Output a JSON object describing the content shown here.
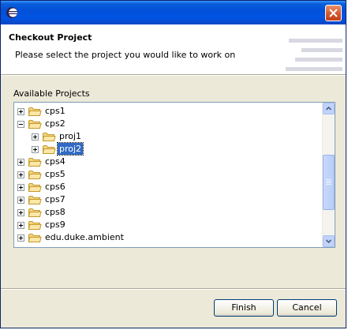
{
  "window": {
    "title": "",
    "close_icon": "close-icon"
  },
  "header": {
    "title": "Checkout Project",
    "description": "Please select the project you would like to work on"
  },
  "tree": {
    "label": "Available Projects",
    "items": [
      {
        "label": "cps1",
        "level": 0,
        "expanded": false,
        "selected": false
      },
      {
        "label": "cps2",
        "level": 0,
        "expanded": true,
        "selected": false
      },
      {
        "label": "proj1",
        "level": 1,
        "expanded": false,
        "selected": false
      },
      {
        "label": "proj2",
        "level": 1,
        "expanded": false,
        "selected": true
      },
      {
        "label": "cps4",
        "level": 0,
        "expanded": false,
        "selected": false
      },
      {
        "label": "cps5",
        "level": 0,
        "expanded": false,
        "selected": false
      },
      {
        "label": "cps6",
        "level": 0,
        "expanded": false,
        "selected": false
      },
      {
        "label": "cps7",
        "level": 0,
        "expanded": false,
        "selected": false
      },
      {
        "label": "cps8",
        "level": 0,
        "expanded": false,
        "selected": false
      },
      {
        "label": "cps9",
        "level": 0,
        "expanded": false,
        "selected": false
      },
      {
        "label": "edu.duke.ambient",
        "level": 0,
        "expanded": false,
        "selected": false
      }
    ]
  },
  "buttons": {
    "finish": "Finish",
    "cancel": "Cancel"
  },
  "colors": {
    "titlebar": "#0054e3",
    "selection": "#316ac5",
    "folder": "#f5d480",
    "dialog_bg": "#ece9d8"
  }
}
